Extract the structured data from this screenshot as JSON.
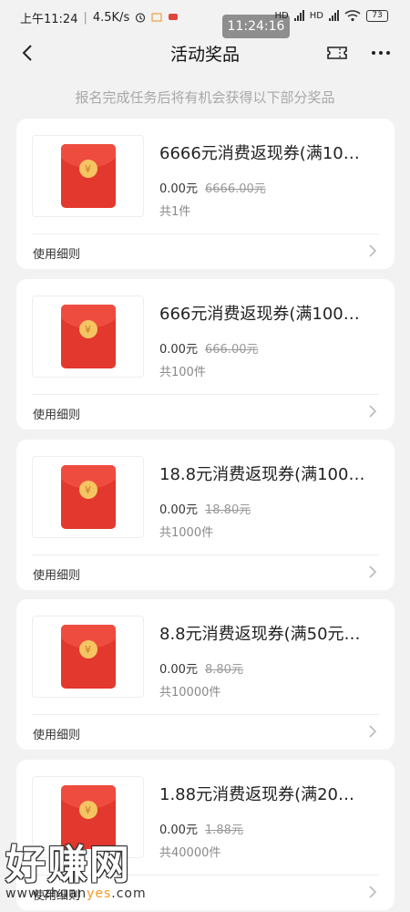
{
  "status_bar": {
    "time": "上午11:24",
    "speed": "4.5K/s",
    "clock_pill": "11:24:16",
    "battery": "73",
    "hd1": "HD",
    "hd2": "HD"
  },
  "header": {
    "title": "活动奖品",
    "back_icon": "back-arrow-icon",
    "ticket_icon": "ticket-icon",
    "more_icon": "more-icon"
  },
  "subtitle": "报名完成任务后将有机会获得以下部分奖品",
  "prizes": [
    {
      "name": "6666元消费返现券(满10…",
      "price": "0.00元",
      "original": "6666.00元",
      "qty": "共1件",
      "rules": "使用细则"
    },
    {
      "name": "666元消费返现券(满100…",
      "price": "0.00元",
      "original": "666.00元",
      "qty": "共100件",
      "rules": "使用细则"
    },
    {
      "name": "18.8元消费返现券(满100…",
      "price": "0.00元",
      "original": "18.80元",
      "qty": "共1000件",
      "rules": "使用细则"
    },
    {
      "name": "8.8元消费返现券(满50元…",
      "price": "0.00元",
      "original": "8.80元",
      "qty": "共10000件",
      "rules": "使用细则"
    },
    {
      "name": "1.88元消费返现券(满20…",
      "price": "0.00元",
      "original": "1.88元",
      "qty": "共40000件",
      "rules": "使用细则"
    }
  ],
  "envelope_symbol": "¥",
  "watermark": {
    "big": "好赚网",
    "url_a": "www.zhuan",
    "url_b": "yes",
    "url_c": ".com"
  },
  "colors": {
    "envelope": "#e3382d",
    "coin": "#f6c562",
    "background": "#f2f2f2"
  }
}
